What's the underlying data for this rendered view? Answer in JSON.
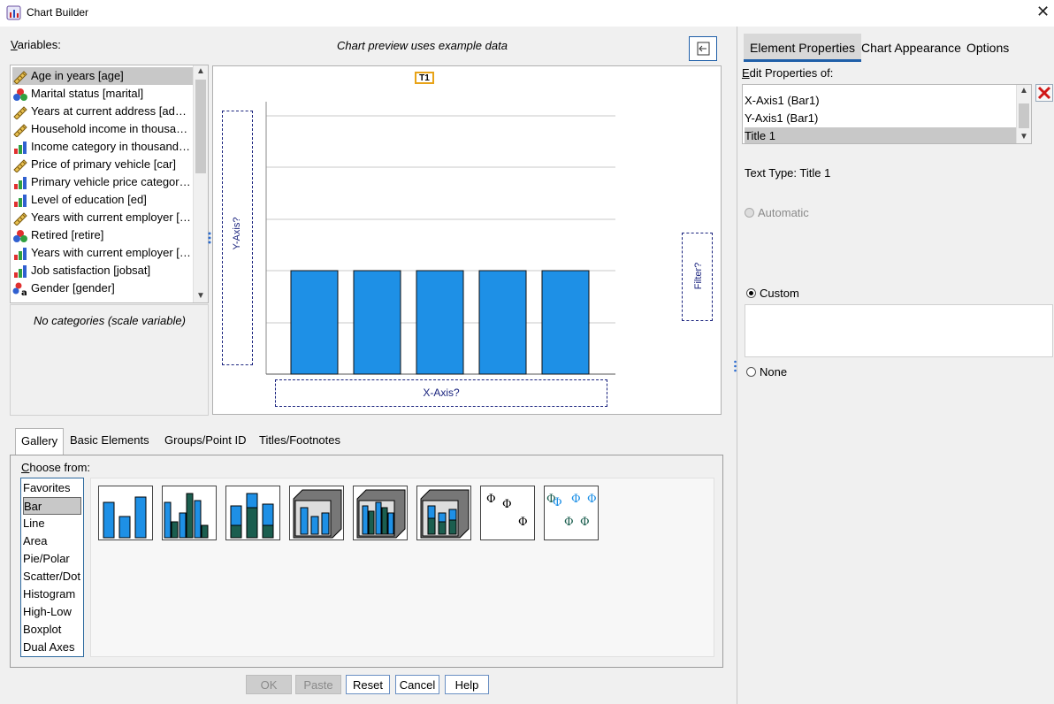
{
  "window": {
    "title": "Chart Builder",
    "close_glyph": "✕"
  },
  "variables": {
    "label": "Variables:",
    "items": [
      {
        "label": "Age in years [age]",
        "icon": "scale-ruler-icon",
        "selected": true
      },
      {
        "label": "Marital status [marital]",
        "icon": "nominal-icon"
      },
      {
        "label": "Years at current address [address]",
        "icon": "scale-ruler-icon"
      },
      {
        "label": "Household income in thousands [income]",
        "icon": "scale-ruler-icon"
      },
      {
        "label": "Income category in thousands [inccat]",
        "icon": "ordinal-bars-icon"
      },
      {
        "label": "Price of primary vehicle [car]",
        "icon": "scale-ruler-icon"
      },
      {
        "label": "Primary vehicle price category [carcat]",
        "icon": "ordinal-bars-icon"
      },
      {
        "label": "Level of education [ed]",
        "icon": "ordinal-bars-icon"
      },
      {
        "label": "Years with current employer [employ]",
        "icon": "scale-ruler-icon"
      },
      {
        "label": "Retired [retire]",
        "icon": "nominal-icon"
      },
      {
        "label": "Years with current employer [empcat]",
        "icon": "ordinal-bars-icon"
      },
      {
        "label": "Job satisfaction [jobsat]",
        "icon": "ordinal-bars-icon"
      },
      {
        "label": "Gender [gender]",
        "icon": "nominal-string-icon"
      }
    ],
    "categories_note": "No categories (scale variable)"
  },
  "preview": {
    "note": "Chart preview uses example data",
    "title_marker": "T1",
    "y_drop_zone": "Y-Axis?",
    "x_drop_zone": "X-Axis?",
    "filter_drop_zone": "Filter?",
    "bar_color": "#1e90e6"
  },
  "gallery": {
    "tabs": [
      "Gallery",
      "Basic Elements",
      "Groups/Point ID",
      "Titles/Footnotes"
    ],
    "active_tab": "Gallery",
    "choose_from_label": "Choose from:",
    "chart_types": [
      "Favorites",
      "Bar",
      "Line",
      "Area",
      "Pie/Polar",
      "Scatter/Dot",
      "Histogram",
      "High-Low",
      "Boxplot",
      "Dual Axes"
    ],
    "selected_type": "Bar"
  },
  "buttons": {
    "ok": "OK",
    "paste": "Paste",
    "reset": "Reset",
    "cancel": "Cancel",
    "help": "Help"
  },
  "properties": {
    "tabs": [
      "Element Properties",
      "Chart Appearance",
      "Options"
    ],
    "edit_label": "Edit Properties of:",
    "items": [
      "X-Axis1 (Bar1)",
      "Y-Axis1 (Bar1)",
      "Title 1"
    ],
    "selected_item": "Title 1",
    "text_type": "Text Type: Title 1",
    "automatic": "Automatic",
    "custom": "Custom",
    "none": "None",
    "custom_value": ""
  }
}
